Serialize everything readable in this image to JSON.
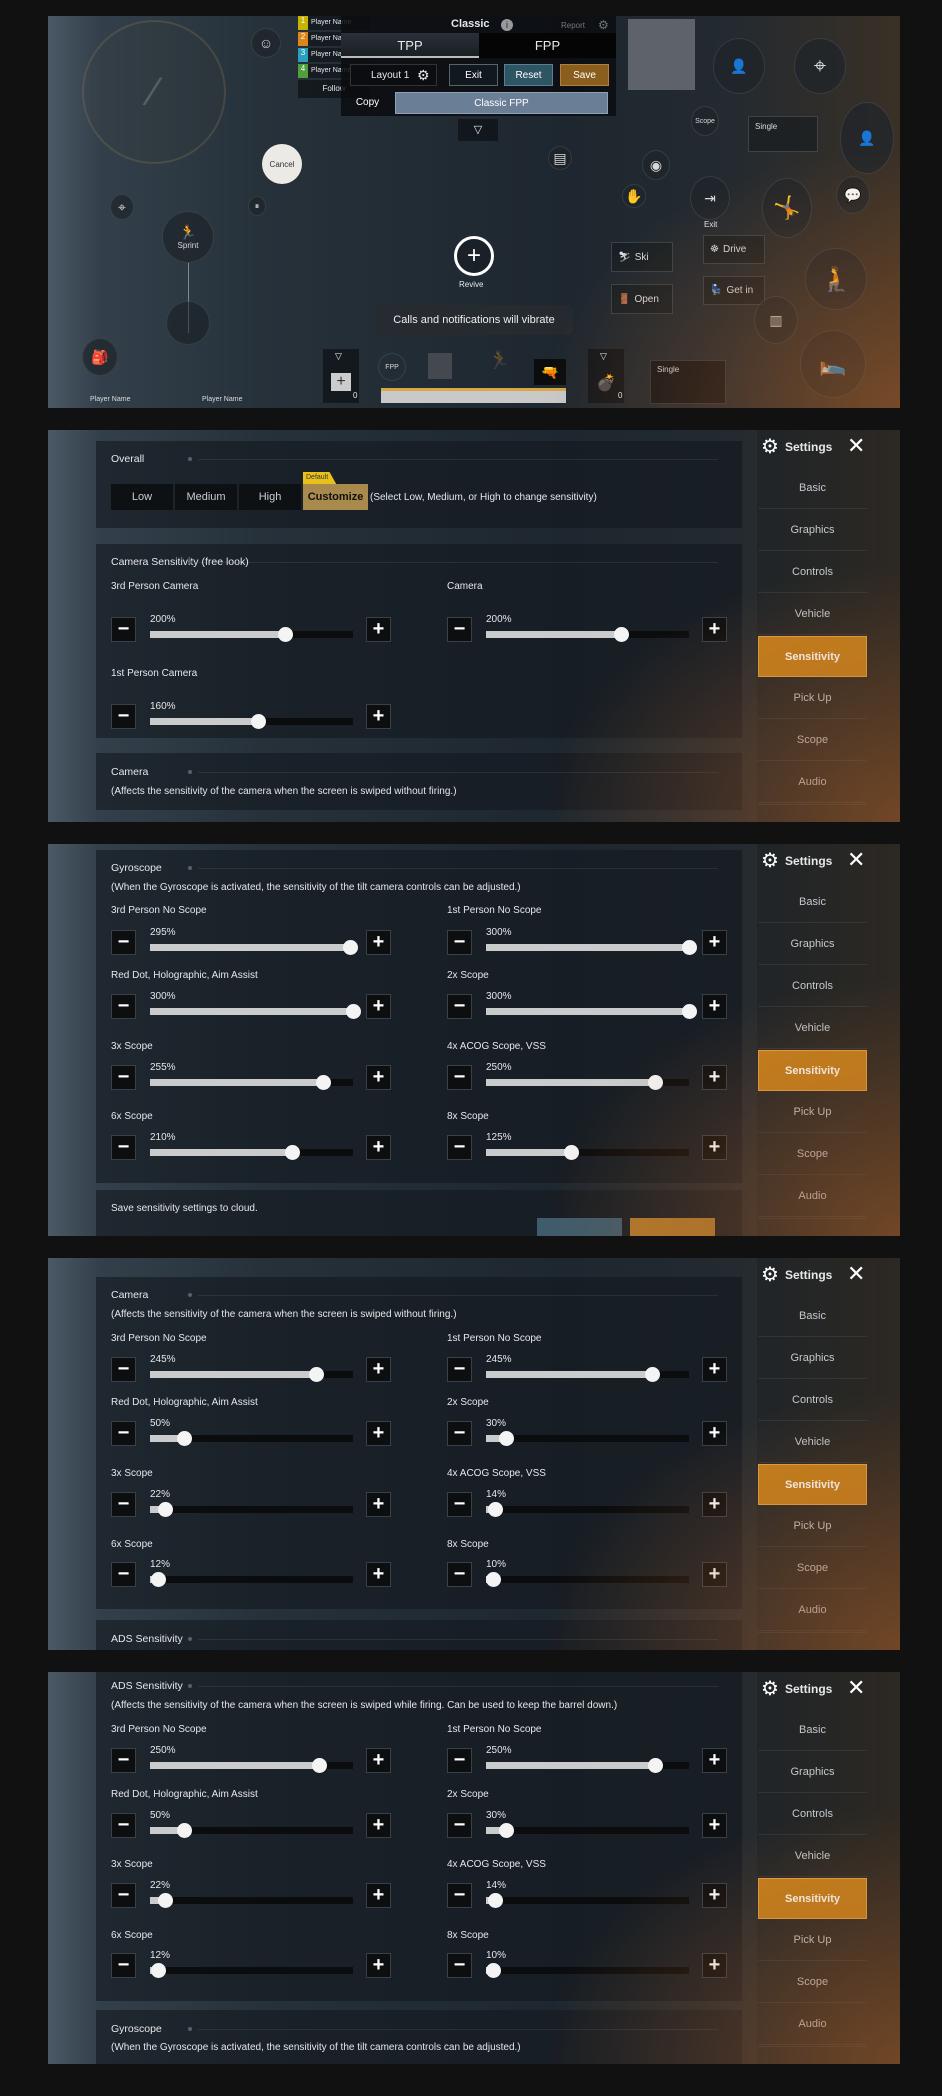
{
  "game_hud": {
    "mode_title": "Classic",
    "report": "Report",
    "tabs": [
      "TPP",
      "FPP"
    ],
    "layout": "Layout 1",
    "exit": "Exit",
    "reset": "Reset",
    "save": "Save",
    "copy": "Copy",
    "preset": "Classic FPP",
    "team": [
      {
        "num": "1",
        "name": "Player Name",
        "color": "#c8b400"
      },
      {
        "num": "2",
        "name": "Player Name",
        "color": "#d9861c"
      },
      {
        "num": "3",
        "name": "Player Name",
        "color": "#2a9fbf"
      },
      {
        "num": "4",
        "name": "Player Name",
        "color": "#4f9f3a"
      }
    ],
    "follow": "Follow",
    "cancel": "Cancel",
    "sprint": "Sprint",
    "revive": "Revive",
    "toast": "Calls and notifications will vibrate",
    "scope": "Scope",
    "single_top": "Single",
    "exit_vehicle": "Exit",
    "ski": "Ski",
    "open": "Open",
    "drive": "Drive",
    "get_in": "Get in",
    "fpp_badge": "FPP",
    "medkit_count": "0",
    "grenade_count": "0",
    "single_bottom": "Single",
    "players": [
      "Player Name",
      "Player Name"
    ]
  },
  "settings": {
    "header": "Settings",
    "nav": [
      "Basic",
      "Graphics",
      "Controls",
      "Vehicle",
      "Sensitivity",
      "Pick Up",
      "Scope",
      "Audio"
    ],
    "active_nav": "Sensitivity",
    "accent": "#c47f1c"
  },
  "screens": [
    {
      "overall": {
        "title": "Overall",
        "options": [
          "Low",
          "Medium",
          "High",
          "Customize"
        ],
        "selected": "Customize",
        "tag": "Default",
        "hint": "(Select Low, Medium, or High to change sensitivity)"
      },
      "free_look": {
        "title": "Camera Sensitivity (free look)",
        "sliders": [
          {
            "label": "3rd Person Camera",
            "value": "200%"
          },
          {
            "label": "Camera",
            "value": "200%"
          },
          {
            "label": "1st Person Camera",
            "value": "160%"
          }
        ]
      },
      "next": {
        "title": "Camera",
        "description": "(Affects the sensitivity of the camera when the screen is swiped without firing.)"
      }
    },
    {
      "section": {
        "title": "Gyroscope",
        "description": "(When the Gyroscope is activated, the sensitivity of the tilt camera controls can be adjusted.)",
        "sliders": [
          {
            "label": "3rd Person No Scope",
            "value": "295%"
          },
          {
            "label": "1st Person No Scope",
            "value": "300%"
          },
          {
            "label": "Red Dot, Holographic, Aim Assist",
            "value": "300%"
          },
          {
            "label": "2x Scope",
            "value": "300%"
          },
          {
            "label": "3x Scope",
            "value": "255%"
          },
          {
            "label": "4x ACOG Scope, VSS",
            "value": "250%"
          },
          {
            "label": "6x Scope",
            "value": "210%"
          },
          {
            "label": "8x Scope",
            "value": "125%"
          }
        ]
      },
      "next": {
        "title": "Save sensitivity settings to cloud."
      }
    },
    {
      "section": {
        "title": "Camera",
        "description": "(Affects the sensitivity of the camera when the screen is swiped without firing.)",
        "sliders": [
          {
            "label": "3rd Person No Scope",
            "value": "245%"
          },
          {
            "label": "1st Person No Scope",
            "value": "245%"
          },
          {
            "label": "Red Dot, Holographic, Aim Assist",
            "value": "50%"
          },
          {
            "label": "2x Scope",
            "value": "30%"
          },
          {
            "label": "3x Scope",
            "value": "22%"
          },
          {
            "label": "4x ACOG Scope, VSS",
            "value": "14%"
          },
          {
            "label": "6x Scope",
            "value": "12%"
          },
          {
            "label": "8x Scope",
            "value": "10%"
          }
        ]
      },
      "next": {
        "title": "ADS Sensitivity"
      }
    },
    {
      "section": {
        "title": "ADS Sensitivity",
        "description": "(Affects the sensitivity of the camera when the screen is swiped while firing. Can be used to keep the barrel down.)",
        "sliders": [
          {
            "label": "3rd Person No Scope",
            "value": "250%"
          },
          {
            "label": "1st Person No Scope",
            "value": "250%"
          },
          {
            "label": "Red Dot, Holographic, Aim Assist",
            "value": "50%"
          },
          {
            "label": "2x Scope",
            "value": "30%"
          },
          {
            "label": "3x Scope",
            "value": "22%"
          },
          {
            "label": "4x ACOG Scope, VSS",
            "value": "14%"
          },
          {
            "label": "6x Scope",
            "value": "12%"
          },
          {
            "label": "8x Scope",
            "value": "10%"
          }
        ]
      },
      "next": {
        "title": "Gyroscope",
        "description": "(When the Gyroscope is activated, the sensitivity of the tilt camera controls can be adjusted.)"
      }
    }
  ]
}
